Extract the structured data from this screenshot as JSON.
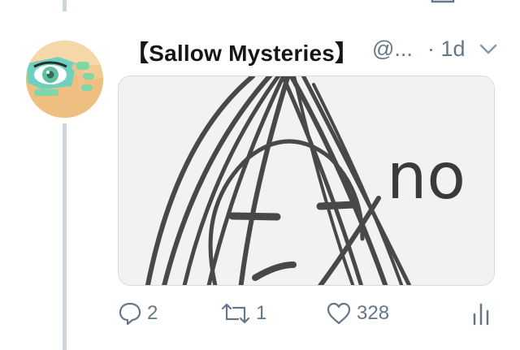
{
  "tweet": {
    "display_name": "【Sallow Mysteries】",
    "handle": "@...",
    "time": "· 1d",
    "actions": {
      "reply_count": "2",
      "retweet_count": "1",
      "like_count": "328"
    },
    "media_text": "no"
  },
  "icons": {
    "reply": "speech-bubble-icon",
    "retweet": "retweet-arrows-icon",
    "like": "heart-icon",
    "analytics": "bar-chart-icon",
    "more": "chevron-down-icon"
  },
  "colors": {
    "muted": "#657786",
    "thread_line": "#ccd6dd",
    "like_red": "#e0245e"
  }
}
